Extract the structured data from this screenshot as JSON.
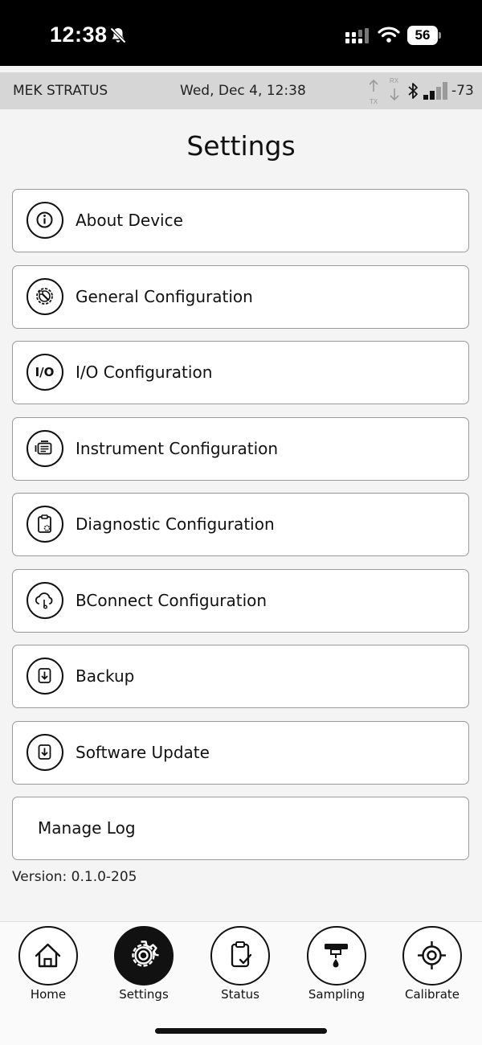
{
  "status_bar": {
    "time": "12:38",
    "battery": "56",
    "icons": [
      "bell-slash-icon",
      "cellular-icon",
      "wifi-icon",
      "battery-icon"
    ]
  },
  "header": {
    "device_name": "MEK STRATUS",
    "date_time": "Wed, Dec 4, 12:38",
    "tx_label": "TX",
    "rx_label": "RX",
    "signal_strength": "-73"
  },
  "page": {
    "title": "Settings"
  },
  "menu": {
    "items": [
      {
        "label": "About Device",
        "icon": "info-icon"
      },
      {
        "label": "General Configuration",
        "icon": "gear-wrench-icon"
      },
      {
        "label": "I/O Configuration",
        "icon": "io-icon"
      },
      {
        "label": "Instrument Configuration",
        "icon": "instrument-icon"
      },
      {
        "label": "Diagnostic Configuration",
        "icon": "clipboard-gear-icon"
      },
      {
        "label": "BConnect Configuration",
        "icon": "cloud-icon"
      },
      {
        "label": "Backup",
        "icon": "download-icon"
      },
      {
        "label": "Software Update",
        "icon": "download-icon"
      },
      {
        "label": "Manage Log",
        "icon": ""
      }
    ]
  },
  "footer": {
    "version_label": "Version:",
    "version_value": "0.1.0-205"
  },
  "nav": {
    "items": [
      {
        "label": "Home",
        "icon": "home-icon",
        "active": false
      },
      {
        "label": "Settings",
        "icon": "gear-icon",
        "active": true
      },
      {
        "label": "Status",
        "icon": "clipboard-check-icon",
        "active": false
      },
      {
        "label": "Sampling",
        "icon": "sampling-icon",
        "active": false
      },
      {
        "label": "Calibrate",
        "icon": "crosshair-icon",
        "active": false
      }
    ]
  },
  "colors": {
    "accent": "#111111",
    "header_bg": "#d6d6d6",
    "page_bg": "#f4f4f4",
    "card_border": "#9a9a9a"
  }
}
